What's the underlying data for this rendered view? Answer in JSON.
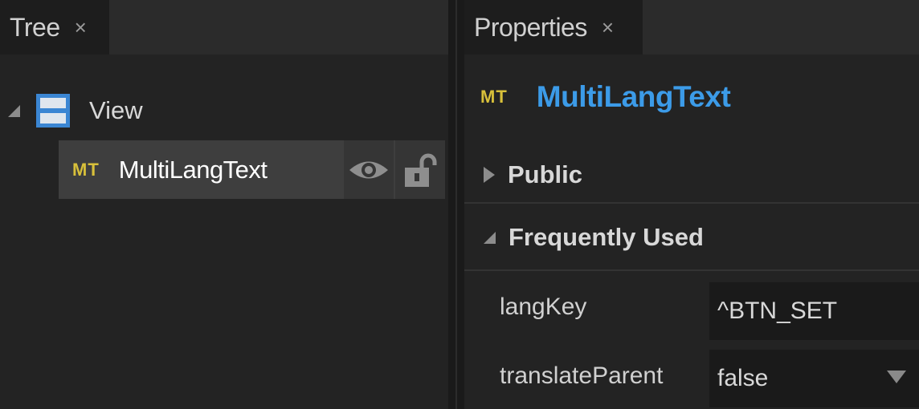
{
  "tree_panel": {
    "tab": {
      "label": "Tree",
      "close": "×"
    },
    "root": {
      "label": "View",
      "icon": "view-layout-icon"
    },
    "child": {
      "badge": "MT",
      "label": "MultiLangText",
      "visibility_icon": "eye-icon",
      "lock_icon": "unlock-icon"
    }
  },
  "properties_panel": {
    "tab": {
      "label": "Properties",
      "close": "×"
    },
    "component": {
      "badge": "MT",
      "name": "MultiLangText"
    },
    "sections": [
      {
        "label": "Public",
        "expanded": false
      },
      {
        "label": "Frequently Used",
        "expanded": true
      }
    ],
    "properties": [
      {
        "name": "langKey",
        "value": "^BTN_SET"
      },
      {
        "name": "translateParent",
        "value": "false"
      }
    ]
  },
  "colors": {
    "accent": "#3c9be8",
    "badge": "#d8c03a",
    "view_icon": "#3b86d3"
  }
}
